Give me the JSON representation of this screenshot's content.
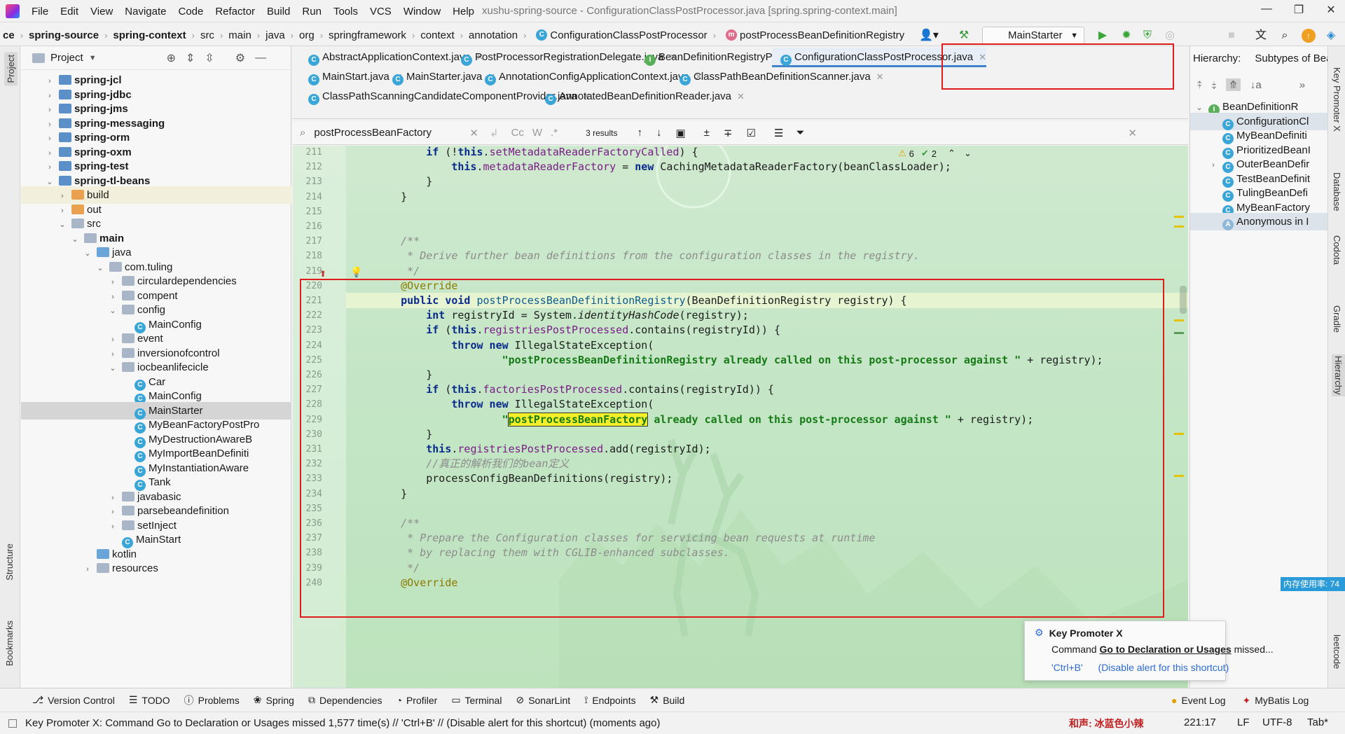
{
  "titlebar": {
    "menu": [
      "File",
      "Edit",
      "View",
      "Navigate",
      "Code",
      "Refactor",
      "Build",
      "Run",
      "Tools",
      "VCS",
      "Window",
      "Help"
    ],
    "title": "xushu-spring-source - ConfigurationClassPostProcessor.java [spring.spring-context.main]"
  },
  "navbar": {
    "breadcrumbs": [
      "ce",
      "spring-source",
      "spring-context",
      "src",
      "main",
      "java",
      "org",
      "springframework",
      "context",
      "annotation",
      "ConfigurationClassPostProcessor",
      "postProcessBeanDefinitionRegistry"
    ],
    "run_config": "MainStarter"
  },
  "project": {
    "title": "Project",
    "rows": [
      {
        "label": "spring-jcl",
        "depth": 0,
        "arrow": "›",
        "icon": "module",
        "bold": true
      },
      {
        "label": "spring-jdbc",
        "depth": 0,
        "arrow": "›",
        "icon": "module",
        "bold": true
      },
      {
        "label": "spring-jms",
        "depth": 0,
        "arrow": "›",
        "icon": "module",
        "bold": true
      },
      {
        "label": "spring-messaging",
        "depth": 0,
        "arrow": "›",
        "icon": "module",
        "bold": true
      },
      {
        "label": "spring-orm",
        "depth": 0,
        "arrow": "›",
        "icon": "module",
        "bold": true
      },
      {
        "label": "spring-oxm",
        "depth": 0,
        "arrow": "›",
        "icon": "module",
        "bold": true
      },
      {
        "label": "spring-test",
        "depth": 0,
        "arrow": "›",
        "icon": "module",
        "bold": true
      },
      {
        "label": "spring-tl-beans",
        "depth": 0,
        "arrow": "⌄",
        "icon": "module",
        "bold": true
      },
      {
        "label": "build",
        "depth": 1,
        "arrow": "›",
        "icon": "orange",
        "bold": false,
        "hl": true
      },
      {
        "label": "out",
        "depth": 1,
        "arrow": "›",
        "icon": "orange",
        "bold": false
      },
      {
        "label": "src",
        "depth": 1,
        "arrow": "⌄",
        "icon": "folder",
        "bold": false
      },
      {
        "label": "main",
        "depth": 2,
        "arrow": "⌄",
        "icon": "folder",
        "bold": true
      },
      {
        "label": "java",
        "depth": 3,
        "arrow": "⌄",
        "icon": "src",
        "bold": false
      },
      {
        "label": "com.tuling",
        "depth": 4,
        "arrow": "⌄",
        "icon": "folder",
        "bold": false
      },
      {
        "label": "circulardependencies",
        "depth": 5,
        "arrow": "›",
        "icon": "folder",
        "bold": false
      },
      {
        "label": "compent",
        "depth": 5,
        "arrow": "›",
        "icon": "folder",
        "bold": false
      },
      {
        "label": "config",
        "depth": 5,
        "arrow": "⌄",
        "icon": "folder",
        "bold": false
      },
      {
        "label": "MainConfig",
        "depth": 6,
        "arrow": "",
        "icon": "class",
        "bold": false
      },
      {
        "label": "event",
        "depth": 5,
        "arrow": "›",
        "icon": "folder",
        "bold": false
      },
      {
        "label": "inversionofcontrol",
        "depth": 5,
        "arrow": "›",
        "icon": "folder",
        "bold": false
      },
      {
        "label": "iocbeanlifecicle",
        "depth": 5,
        "arrow": "⌄",
        "icon": "folder",
        "bold": false
      },
      {
        "label": "Car",
        "depth": 6,
        "arrow": "",
        "icon": "class",
        "bold": false
      },
      {
        "label": "MainConfig",
        "depth": 6,
        "arrow": "",
        "icon": "class",
        "bold": false
      },
      {
        "label": "MainStarter",
        "depth": 6,
        "arrow": "",
        "icon": "class",
        "bold": false,
        "sel": true
      },
      {
        "label": "MyBeanFactoryPostPro",
        "depth": 6,
        "arrow": "",
        "icon": "class",
        "bold": false
      },
      {
        "label": "MyDestructionAwareB",
        "depth": 6,
        "arrow": "",
        "icon": "class",
        "bold": false
      },
      {
        "label": "MyImportBeanDefiniti",
        "depth": 6,
        "arrow": "",
        "icon": "class",
        "bold": false
      },
      {
        "label": "MyInstantiationAware",
        "depth": 6,
        "arrow": "",
        "icon": "class",
        "bold": false
      },
      {
        "label": "Tank",
        "depth": 6,
        "arrow": "",
        "icon": "class",
        "bold": false
      },
      {
        "label": "javabasic",
        "depth": 5,
        "arrow": "›",
        "icon": "folder",
        "bold": false
      },
      {
        "label": "parsebeandefinition",
        "depth": 5,
        "arrow": "›",
        "icon": "folder",
        "bold": false
      },
      {
        "label": "setInject",
        "depth": 5,
        "arrow": "›",
        "icon": "folder",
        "bold": false
      },
      {
        "label": "MainStart",
        "depth": 5,
        "arrow": "",
        "icon": "class",
        "bold": false
      },
      {
        "label": "kotlin",
        "depth": 3,
        "arrow": "",
        "icon": "src",
        "bold": false
      },
      {
        "label": "resources",
        "depth": 3,
        "arrow": "›",
        "icon": "folder",
        "bold": false
      }
    ]
  },
  "tabs": {
    "row1": [
      {
        "label": "AbstractApplicationContext.java",
        "icon": "C"
      },
      {
        "label": "PostProcessorRegistrationDelegate.java",
        "icon": "C"
      },
      {
        "label": "BeanDefinitionRegistryPostProcessor.java",
        "icon": "I"
      },
      {
        "label": "ConfigurationClassPostProcessor.java",
        "icon": "C",
        "active": true
      }
    ],
    "row2": [
      {
        "label": "MainStart.java",
        "icon": "C"
      },
      {
        "label": "MainStarter.java",
        "icon": "C"
      },
      {
        "label": "AnnotationConfigApplicationContext.java",
        "icon": "C"
      },
      {
        "label": "ClassPathBeanDefinitionScanner.java",
        "icon": "C"
      }
    ],
    "row3": [
      {
        "label": "ClassPathScanningCandidateComponentProvider.java",
        "icon": "C"
      },
      {
        "label": "AnnotatedBeanDefinitionReader.java",
        "icon": "C"
      }
    ]
  },
  "search": {
    "query": "postProcessBeanFactory",
    "results": "3 results",
    "opt_case": "Cc",
    "opt_word": "W"
  },
  "editor": {
    "warnings": "6",
    "weak_warnings": "2",
    "lines": [
      {
        "n": "211",
        "html": "        <span class=kw>if</span> (!<span class=kw>this</span>.<span class=fld>setMetadataReaderFactoryCalled</span>) {"
      },
      {
        "n": "212",
        "html": "            <span class=kw>this</span>.<span class=fld>metadataReaderFactory</span> = <span class=kw>new</span> CachingMetadataReaderFactory(beanClassLoader);"
      },
      {
        "n": "213",
        "html": "        }"
      },
      {
        "n": "214",
        "html": "    }"
      },
      {
        "n": "215",
        "html": ""
      },
      {
        "n": "216",
        "html": ""
      },
      {
        "n": "217",
        "html": "    <span class=cm>/**</span>"
      },
      {
        "n": "218",
        "html": "<span class=cm>     * Derive further bean definitions from the configuration classes in the registry.</span>"
      },
      {
        "n": "219",
        "html": "<span class=cm>     */</span>"
      },
      {
        "n": "220",
        "html": "    <span class=ann>@Override</span>"
      },
      {
        "n": "221",
        "html": "    <span class=kw>public void</span> <span class=mth>postProcessBeanDefinitionRegistry</span>(BeanDefinitionRegistry registry) {"
      },
      {
        "n": "222",
        "html": "        <span class=kw>int</span> registryId = System.<i>identityHashCode</i>(registry);"
      },
      {
        "n": "223",
        "html": "        <span class=kw>if</span> (<span class=kw>this</span>.<span class=fld>registriesPostProcessed</span>.contains(registryId)) {"
      },
      {
        "n": "224",
        "html": "            <span class=kw>throw new</span> IllegalStateException("
      },
      {
        "n": "225",
        "html": "                    <span class=str>\"postProcessBeanDefinitionRegistry already called on this post-processor against \"</span> + registry);"
      },
      {
        "n": "226",
        "html": "        }"
      },
      {
        "n": "227",
        "html": "        <span class=kw>if</span> (<span class=kw>this</span>.<span class=fld>factoriesPostProcessed</span>.contains(registryId)) {"
      },
      {
        "n": "228",
        "html": "            <span class=kw>throw new</span> IllegalStateException("
      },
      {
        "n": "229",
        "html": "                    <span class=str>\"<span class=hlfind>postProcessBeanFactory</span> already called on this post-processor against \"</span> + registry);"
      },
      {
        "n": "230",
        "html": "        }"
      },
      {
        "n": "231",
        "html": "        <span class=kw>this</span>.<span class=fld>registriesPostProcessed</span>.add(registryId);"
      },
      {
        "n": "232",
        "html": "        <span class=cm>//真正的解析我们的bean定义</span>"
      },
      {
        "n": "233",
        "html": "        processConfigBeanDefinitions(registry);"
      },
      {
        "n": "234",
        "html": "    }"
      },
      {
        "n": "235",
        "html": ""
      },
      {
        "n": "236",
        "html": "    <span class=cm>/**</span>"
      },
      {
        "n": "237",
        "html": "<span class=cm>     * Prepare the Configuration classes for servicing bean requests at runtime</span>"
      },
      {
        "n": "238",
        "html": "<span class=cm>     * by replacing them with CGLIB-enhanced subclasses.</span>"
      },
      {
        "n": "239",
        "html": "<span class=cm>     */</span>"
      },
      {
        "n": "240",
        "html": "    <span class=ann>@Override</span>"
      }
    ]
  },
  "hierarchy": {
    "label": "Hierarchy:",
    "mode": "Subtypes of Bea",
    "rows": [
      {
        "label": "BeanDefinitionR",
        "depth": 0,
        "icon": "I",
        "arrow": "⌄"
      },
      {
        "label": "ConfigurationCl",
        "depth": 1,
        "icon": "C",
        "arrow": "",
        "sel": true
      },
      {
        "label": "MyBeanDefiniti",
        "depth": 1,
        "icon": "C",
        "arrow": ""
      },
      {
        "label": "PrioritizedBeanI",
        "depth": 1,
        "icon": "C",
        "arrow": ""
      },
      {
        "label": "OuterBeanDefir",
        "depth": 1,
        "icon": "C",
        "arrow": "›"
      },
      {
        "label": "TestBeanDefinit",
        "depth": 1,
        "icon": "C",
        "arrow": ""
      },
      {
        "label": "TulingBeanDefi",
        "depth": 1,
        "icon": "C",
        "arrow": ""
      },
      {
        "label": "MyBeanFactory",
        "depth": 1,
        "icon": "C",
        "arrow": ""
      },
      {
        "label": "Anonymous in I",
        "depth": 1,
        "icon": "A",
        "arrow": "",
        "sel": true
      }
    ]
  },
  "side_tools": {
    "left": [
      "Project",
      "Structure",
      "Bookmarks"
    ],
    "right": [
      "Key Promoter X",
      "Database",
      "Codota",
      "Gradle",
      "Hierarchy",
      "leetcode"
    ]
  },
  "bottom_tools": [
    "Version Control",
    "TODO",
    "Problems",
    "Spring",
    "Dependencies",
    "Profiler",
    "Terminal",
    "SonarLint",
    "Endpoints",
    "Build"
  ],
  "bottom_tools_right": [
    "Event Log",
    "MyBatis Log"
  ],
  "status": {
    "message": "Key Promoter X: Command Go to Declaration or Usages missed 1,577 time(s) // 'Ctrl+B' // (Disable alert for this shortcut) (moments ago)",
    "watermark": "和声: 冰蓝色小辣",
    "position": "221:17",
    "line_sep": "LF",
    "encoding": "UTF-8",
    "indent": "Tab*"
  },
  "popup": {
    "title": "Key Promoter X",
    "prefix": "Command ",
    "action": "Go to Declaration or Usages",
    "suffix": " missed...",
    "shortcut": "'Ctrl+B'",
    "disable": "(Disable alert for this shortcut)"
  },
  "memory": "内存使用率: 74"
}
